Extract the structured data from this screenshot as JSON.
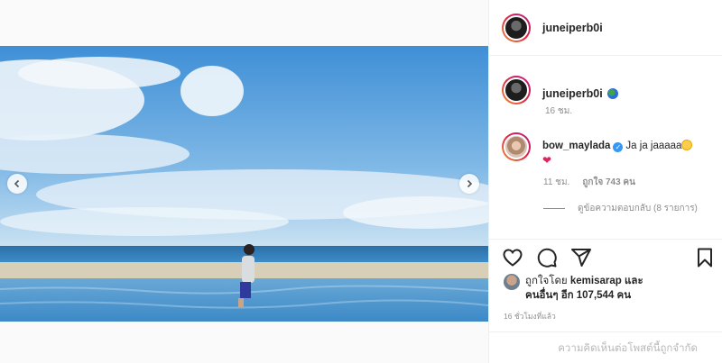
{
  "post": {
    "author": "juneiperb0i",
    "caption_time": "16 ชม.",
    "liked_by_prefix": "ถูกใจโดย",
    "liked_by_user": "kemisarap",
    "liked_by_and": "และ",
    "liked_by_others": "คนอื่นๆ อีก 107,544 คน",
    "posted_ago": "16 ชั่วโมงที่แล้ว",
    "comments_limited_text": "ความคิดเห็นต่อโพสต์นี้ถูกจำกัด"
  },
  "comment": {
    "username": "bow_maylada",
    "text": "Ja ja jaaaaa",
    "time": "11 ชม.",
    "likes": "ถูกใจ 743 คน",
    "view_replies": "ดูข้อความตอบกลับ (8 รายการ)"
  },
  "icons": {
    "like": "heart-icon",
    "comment": "comment-icon",
    "share": "share-icon",
    "save": "bookmark-icon",
    "prev": "chevron-left-icon",
    "next": "chevron-right-icon",
    "verified": "verified-icon"
  },
  "colors": {
    "verified": "#3897f0",
    "muted_text": "#8e8e8e",
    "heart": "#e0245e"
  }
}
